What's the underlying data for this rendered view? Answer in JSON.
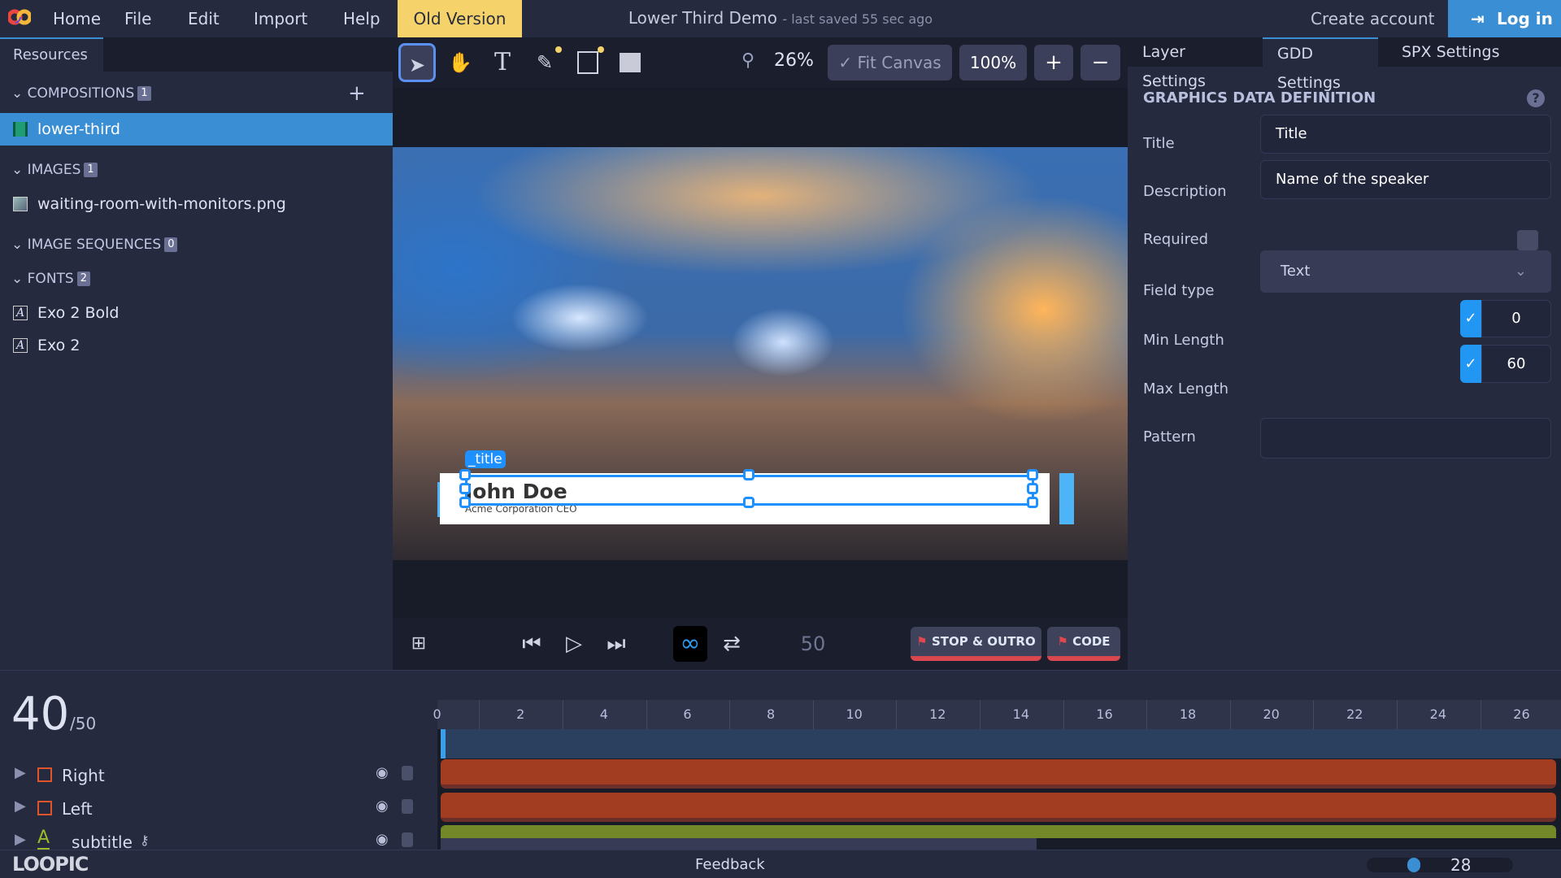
{
  "menu": {
    "home": "Home",
    "file": "File",
    "edit": "Edit",
    "import": "Import",
    "help": "Help",
    "old_version": "Old Version"
  },
  "doc": {
    "title": "Lower Third Demo",
    "saved": "- last saved 55 sec ago"
  },
  "account": {
    "create": "Create account",
    "login": "Log in"
  },
  "left": {
    "tab": "Resources",
    "compositions": {
      "label": "COMPOSITIONS",
      "count": "1",
      "items": [
        "lower-third"
      ]
    },
    "images": {
      "label": "IMAGES",
      "count": "1",
      "items": [
        "waiting-room-with-monitors.png"
      ]
    },
    "sequences": {
      "label": "IMAGE SEQUENCES",
      "count": "0"
    },
    "fonts": {
      "label": "FONTS",
      "count": "2",
      "items": [
        "Exo 2 Bold",
        "Exo 2"
      ]
    }
  },
  "toolbar": {
    "zoom": "26%",
    "fit": "Fit Canvas",
    "hundred": "100%",
    "plus": "+",
    "minus": "−"
  },
  "canvas": {
    "tag": "_title",
    "name": "John Doe",
    "subtitle": "Acme Corporation CEO"
  },
  "transport": {
    "end_frame": "50",
    "stop_outro": "STOP & OUTRO",
    "code": "CODE"
  },
  "right": {
    "tabs": [
      "Layer Settings",
      "GDD Settings",
      "SPX Settings"
    ],
    "active_tab": "GDD Settings",
    "heading": "GRAPHICS DATA DEFINITION",
    "title_label": "Title",
    "title_value": "Title",
    "desc_label": "Description",
    "desc_value": "Name of the speaker",
    "required_label": "Required",
    "required": false,
    "type_label": "Field type",
    "type_value": "Text",
    "min_label": "Min Length",
    "min_value": "0",
    "min_enabled": true,
    "max_label": "Max Length",
    "max_value": "60",
    "max_enabled": true,
    "pattern_label": "Pattern",
    "pattern_value": ""
  },
  "timeline": {
    "frame": "40",
    "total": "/50",
    "ticks": [
      "0",
      "2",
      "4",
      "6",
      "8",
      "10",
      "12",
      "14",
      "16",
      "18",
      "20",
      "22",
      "24",
      "26"
    ],
    "layers": [
      {
        "name": "Right",
        "type": "rect",
        "color": "#e0542c"
      },
      {
        "name": "Left",
        "type": "rect",
        "color": "#e0542c"
      },
      {
        "name": "subtitle",
        "type": "text",
        "color": "#9bbb2c"
      }
    ]
  },
  "footer": {
    "logo": "LOOPIC",
    "feedback": "Feedback",
    "zoom_value": "28"
  }
}
